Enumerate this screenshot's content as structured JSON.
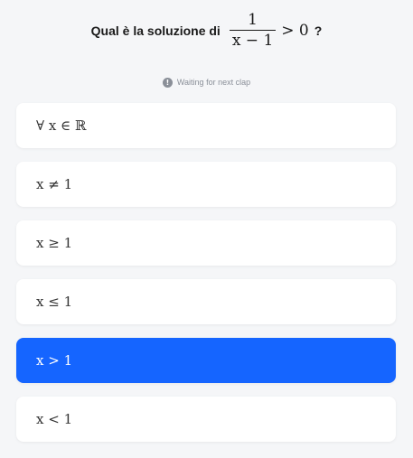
{
  "question": {
    "text": "Qual è la soluzione di",
    "fraction_numerator": "1",
    "fraction_denominator": "x − 1",
    "relation": "> 0",
    "question_mark": "?"
  },
  "status": {
    "icon": "info-icon",
    "text": "Waiting for next clap"
  },
  "colors": {
    "selected": "#1565ff",
    "background": "#f5f6f8"
  },
  "options": [
    {
      "label": "∀ x ∈ ℝ",
      "selected": false
    },
    {
      "label": "x ≠ 1",
      "selected": false
    },
    {
      "label": "x ≥ 1",
      "selected": false
    },
    {
      "label": "x ≤ 1",
      "selected": false
    },
    {
      "label": "x > 1",
      "selected": true
    },
    {
      "label": "x < 1",
      "selected": false
    }
  ]
}
